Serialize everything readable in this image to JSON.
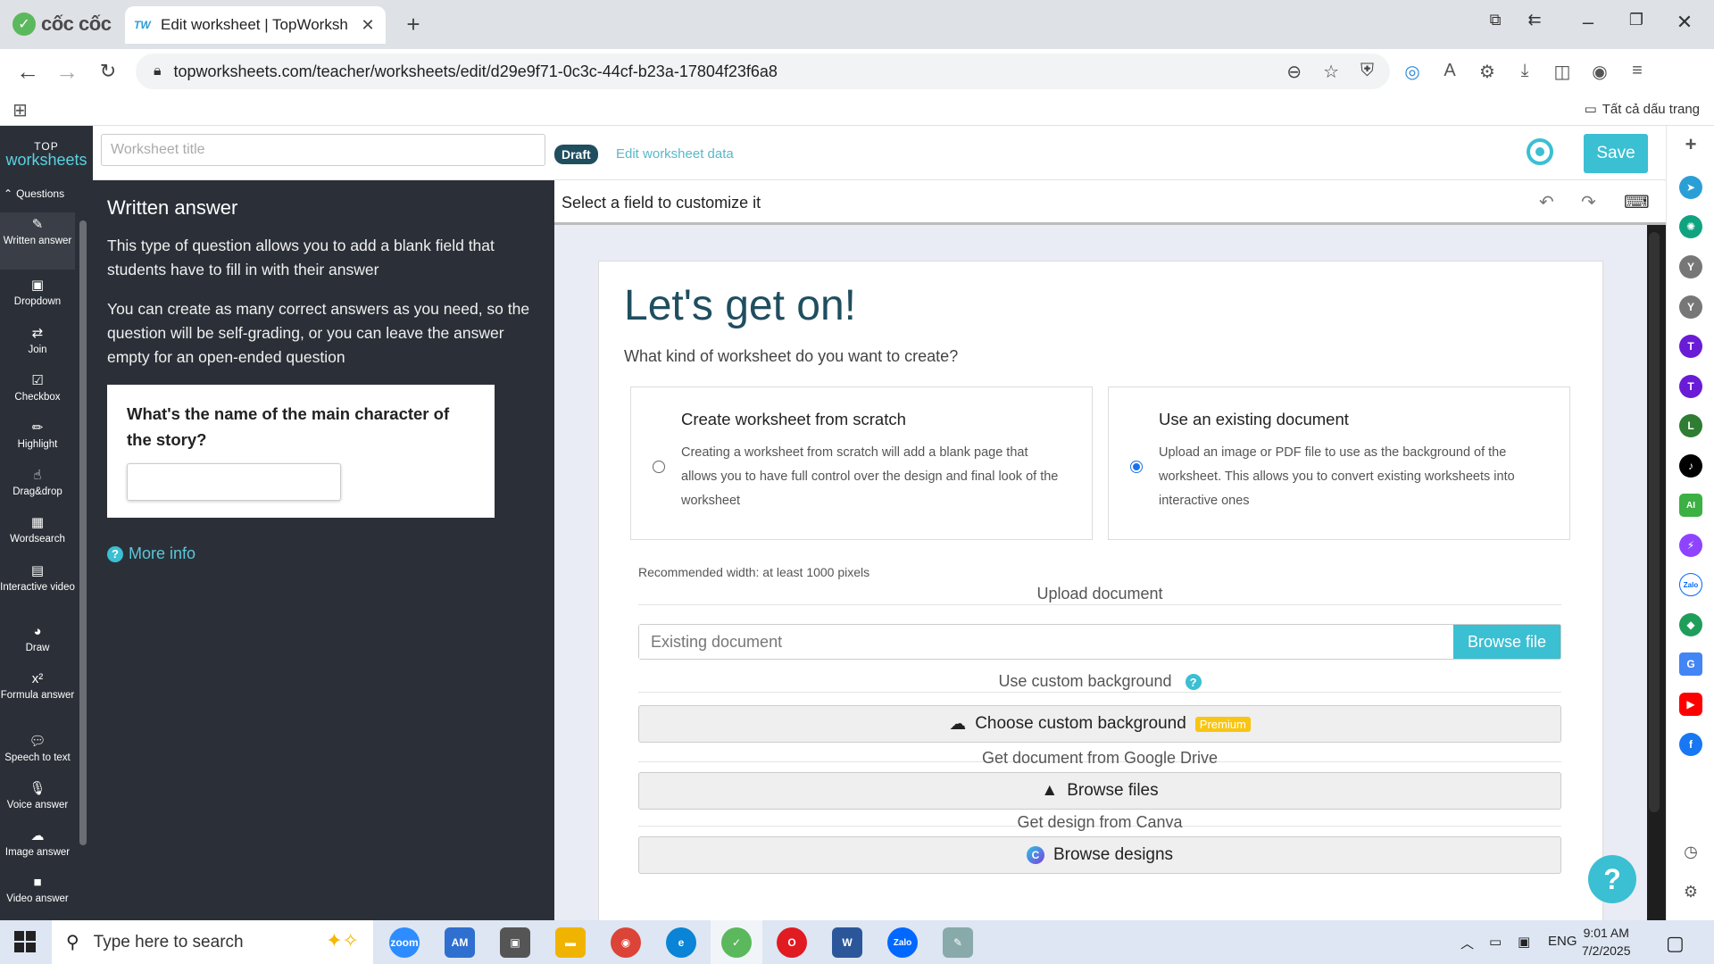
{
  "browser": {
    "brand_name": "cốc cốc",
    "tab_favicon": "TW",
    "tab_title": "Edit worksheet | TopWorksheets",
    "url": "topworksheets.com/teacher/worksheets/edit/d29e9f71-0c3c-44cf-b23a-17804f23f6a8",
    "bookmarks_all": "Tất cả dấu trang"
  },
  "header": {
    "logo_top": "TOP",
    "logo_main": "worksheets",
    "title_placeholder": "Worksheet title",
    "draft": "Draft",
    "edit_data": "Edit worksheet data",
    "save": "Save"
  },
  "toolbar": {
    "header": "Questions",
    "items": [
      {
        "label": "Written answer",
        "icon": "edit-icon"
      },
      {
        "label": "Dropdown",
        "icon": "dropdown-icon"
      },
      {
        "label": "Join",
        "icon": "join-icon"
      },
      {
        "label": "Checkbox",
        "icon": "checkbox-icon"
      },
      {
        "label": "Highlight",
        "icon": "highlight-icon"
      },
      {
        "label": "Drag&drop",
        "icon": "drag-icon"
      },
      {
        "label": "Wordsearch",
        "icon": "grid-icon"
      },
      {
        "label": "Interactive video",
        "icon": "video-file-icon"
      },
      {
        "label": "Draw",
        "icon": "palette-icon"
      },
      {
        "label": "Formula answer",
        "icon": "formula-icon"
      },
      {
        "label": "Speech to text",
        "icon": "speech-icon"
      },
      {
        "label": "Voice answer",
        "icon": "microphone-icon"
      },
      {
        "label": "Image answer",
        "icon": "cloud-upload-icon"
      },
      {
        "label": "Video answer",
        "icon": "camera-icon"
      }
    ]
  },
  "help": {
    "title": "Written answer",
    "p1": "This type of question allows you to add a blank field that students have to fill in with their answer",
    "p2": "You can create as many correct answers as you need, so the question will be self-grading, or you can leave the answer empty for an open-ended question",
    "sample_question": "What's the name of the main character of the story?",
    "more_info": "More info"
  },
  "editor": {
    "hint": "Select a field to customize it"
  },
  "card": {
    "heading": "Let's get on!",
    "subheading": "What kind of worksheet do you want to create?",
    "option_scratch": {
      "title": "Create worksheet from scratch",
      "desc": "Creating a worksheet from scratch will add a blank page that allows you to have full control over the design and final look of the worksheet",
      "selected": false
    },
    "option_existing": {
      "title": "Use an existing document",
      "desc": "Upload an image or PDF file to use as the background of the worksheet. This allows you to convert existing worksheets into interactive ones",
      "selected": true
    },
    "recommended": "Recommended width: at least 1000 pixels",
    "upload_label": "Upload document",
    "upload_placeholder": "Existing document",
    "browse_file": "Browse file",
    "custom_bg_label": "Use custom background",
    "custom_bg_button": "Choose custom background",
    "premium": "Premium",
    "gdrive_label": "Get document from Google Drive",
    "gdrive_button": "Browse files",
    "canva_label": "Get design from Canva",
    "canva_button": "Browse designs"
  },
  "taskbar": {
    "search_placeholder": "Type here to search",
    "lang": "ENG",
    "time": "9:01 AM",
    "date": "7/2/2025"
  },
  "colors": {
    "accent": "#3bbfd2",
    "dark_panel": "#2b3038",
    "heading": "#1f4e5f",
    "premium": "#f8c513"
  }
}
